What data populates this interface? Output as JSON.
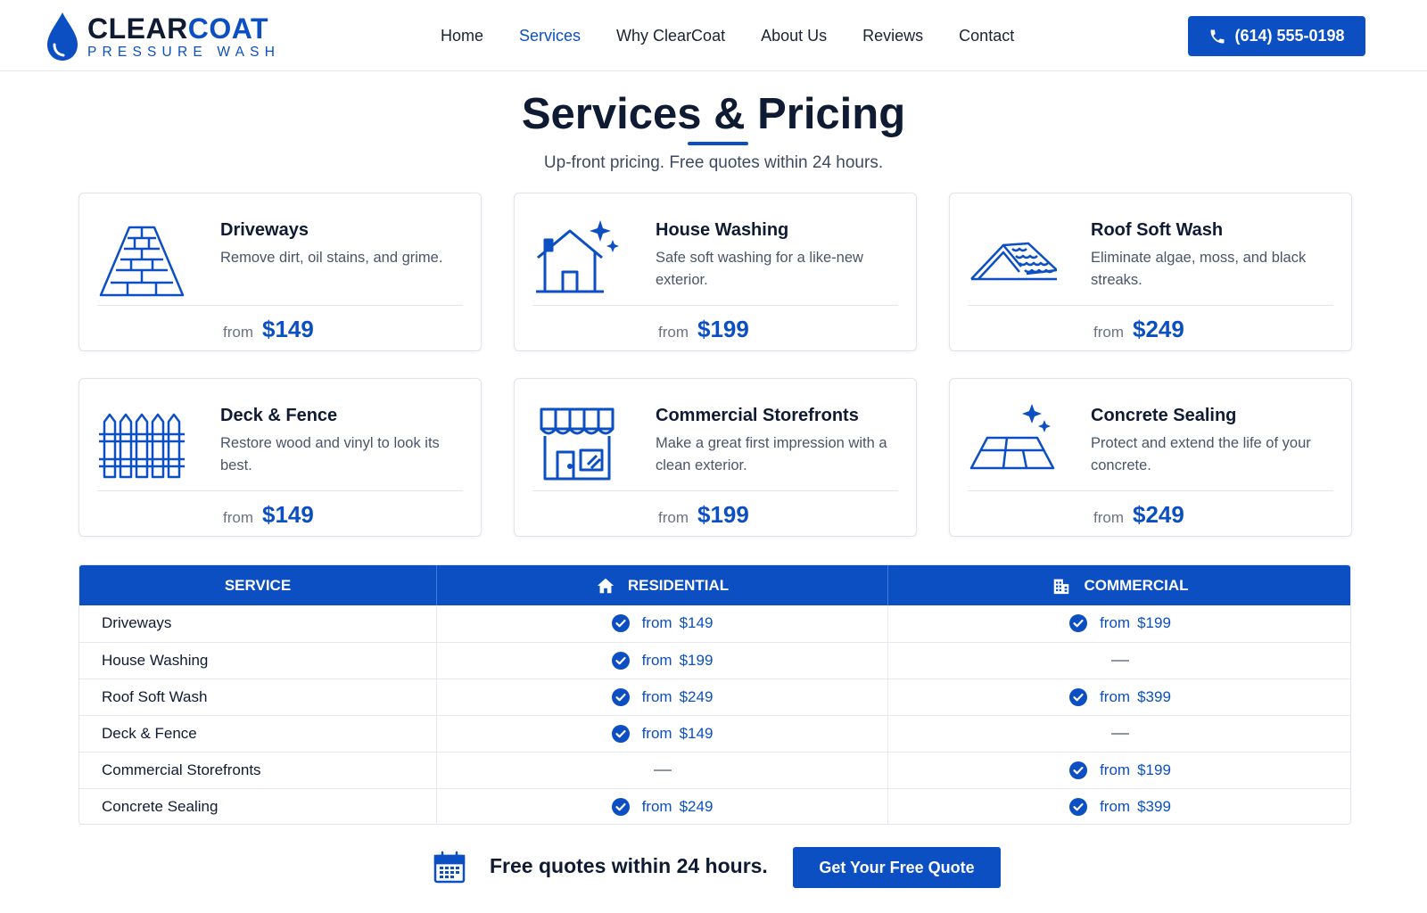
{
  "brand": {
    "name_part1": "CLEAR",
    "name_part2": "COAT",
    "tagline": "PRESSURE WASH",
    "accent_color": "#0b4fc3"
  },
  "nav": {
    "items": [
      {
        "label": "Home",
        "active": false
      },
      {
        "label": "Services",
        "active": true
      },
      {
        "label": "Why ClearCoat",
        "active": false
      },
      {
        "label": "About Us",
        "active": false
      },
      {
        "label": "Reviews",
        "active": false
      },
      {
        "label": "Contact",
        "active": false
      }
    ],
    "phone_label": "(614) 555-0198",
    "phone_icon": "phone-icon"
  },
  "hero": {
    "title": "Services & Pricing",
    "subtitle": "Up-front pricing. Free quotes within 24 hours."
  },
  "services": [
    {
      "icon": "driveway-icon",
      "title": "Driveways",
      "description": "Remove dirt, oil stains, and grime.",
      "from_label": "from",
      "price": "$149"
    },
    {
      "icon": "house-sparkle-icon",
      "title": "House Washing",
      "description": "Safe soft washing for a like-new exterior.",
      "from_label": "from",
      "price": "$199"
    },
    {
      "icon": "roof-icon",
      "title": "Roof Soft Wash",
      "description": "Eliminate algae, moss, and black streaks.",
      "from_label": "from",
      "price": "$249"
    },
    {
      "icon": "fence-icon",
      "title": "Deck & Fence",
      "description": "Restore wood and vinyl to look its best.",
      "from_label": "from",
      "price": "$149"
    },
    {
      "icon": "storefront-icon",
      "title": "Commercial Storefronts",
      "description": "Make a great first impression with a clean exterior.",
      "from_label": "from",
      "price": "$199"
    },
    {
      "icon": "concrete-sparkle-icon",
      "title": "Concrete Sealing",
      "description": "Protect and extend the life of your concrete.",
      "from_label": "from",
      "price": "$249"
    }
  ],
  "table": {
    "headers": {
      "service": "SERVICE",
      "residential": "RESIDENTIAL",
      "commercial": "COMMERCIAL"
    },
    "header_icons": {
      "residential": "home-icon",
      "commercial": "building-icon"
    },
    "rows": [
      {
        "service": "Driveways",
        "residential": {
          "available": true,
          "from": "from",
          "price": "$149"
        },
        "commercial": {
          "available": true,
          "from": "from",
          "price": "$199"
        }
      },
      {
        "service": "House Washing",
        "residential": {
          "available": true,
          "from": "from",
          "price": "$199"
        },
        "commercial": {
          "available": false
        }
      },
      {
        "service": "Roof Soft Wash",
        "residential": {
          "available": true,
          "from": "from",
          "price": "$249"
        },
        "commercial": {
          "available": true,
          "from": "from",
          "price": "$399"
        }
      },
      {
        "service": "Deck & Fence",
        "residential": {
          "available": true,
          "from": "from",
          "price": "$149"
        },
        "commercial": {
          "available": false
        }
      },
      {
        "service": "Commercial Storefronts",
        "residential": {
          "available": false
        },
        "commercial": {
          "available": true,
          "from": "from",
          "price": "$199"
        }
      },
      {
        "service": "Concrete Sealing",
        "residential": {
          "available": true,
          "from": "from",
          "price": "$249"
        },
        "commercial": {
          "available": true,
          "from": "from",
          "price": "$399"
        }
      }
    ]
  },
  "cta": {
    "icon": "calendar-icon",
    "text": "Free quotes within 24 hours.",
    "button_label": "Get Your Free Quote"
  }
}
